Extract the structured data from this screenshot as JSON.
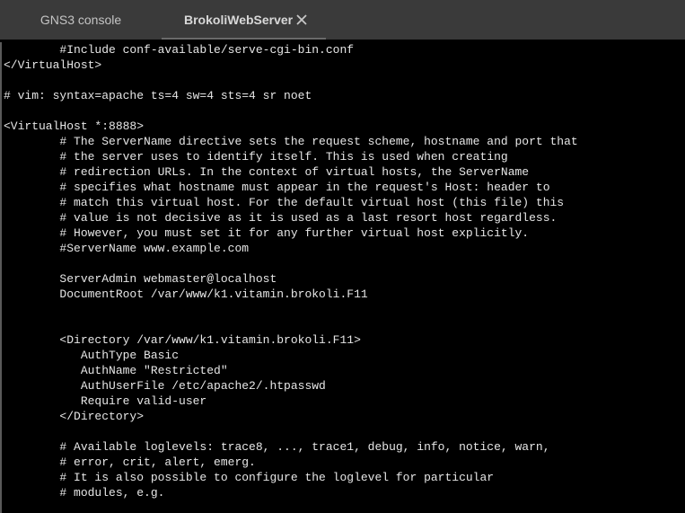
{
  "tabs": [
    {
      "label": "GNS3 console"
    },
    {
      "label": "BrokoliWebServer"
    }
  ],
  "terminal": {
    "lines": [
      "        #Include conf-available/serve-cgi-bin.conf",
      "</VirtualHost>",
      "",
      "# vim: syntax=apache ts=4 sw=4 sts=4 sr noet",
      "",
      "<VirtualHost *:8888>",
      "        # The ServerName directive sets the request scheme, hostname and port that",
      "        # the server uses to identify itself. This is used when creating",
      "        # redirection URLs. In the context of virtual hosts, the ServerName",
      "        # specifies what hostname must appear in the request's Host: header to",
      "        # match this virtual host. For the default virtual host (this file) this",
      "        # value is not decisive as it is used as a last resort host regardless.",
      "        # However, you must set it for any further virtual host explicitly.",
      "        #ServerName www.example.com",
      "",
      "        ServerAdmin webmaster@localhost",
      "        DocumentRoot /var/www/k1.vitamin.brokoli.F11",
      "",
      "",
      "        <Directory /var/www/k1.vitamin.brokoli.F11>",
      "           AuthType Basic",
      "           AuthName \"Restricted\"",
      "           AuthUserFile /etc/apache2/.htpasswd",
      "           Require valid-user",
      "        </Directory>",
      "",
      "        # Available loglevels: trace8, ..., trace1, debug, info, notice, warn,",
      "        # error, crit, alert, emerg.",
      "        # It is also possible to configure the loglevel for particular",
      "        # modules, e.g."
    ]
  }
}
